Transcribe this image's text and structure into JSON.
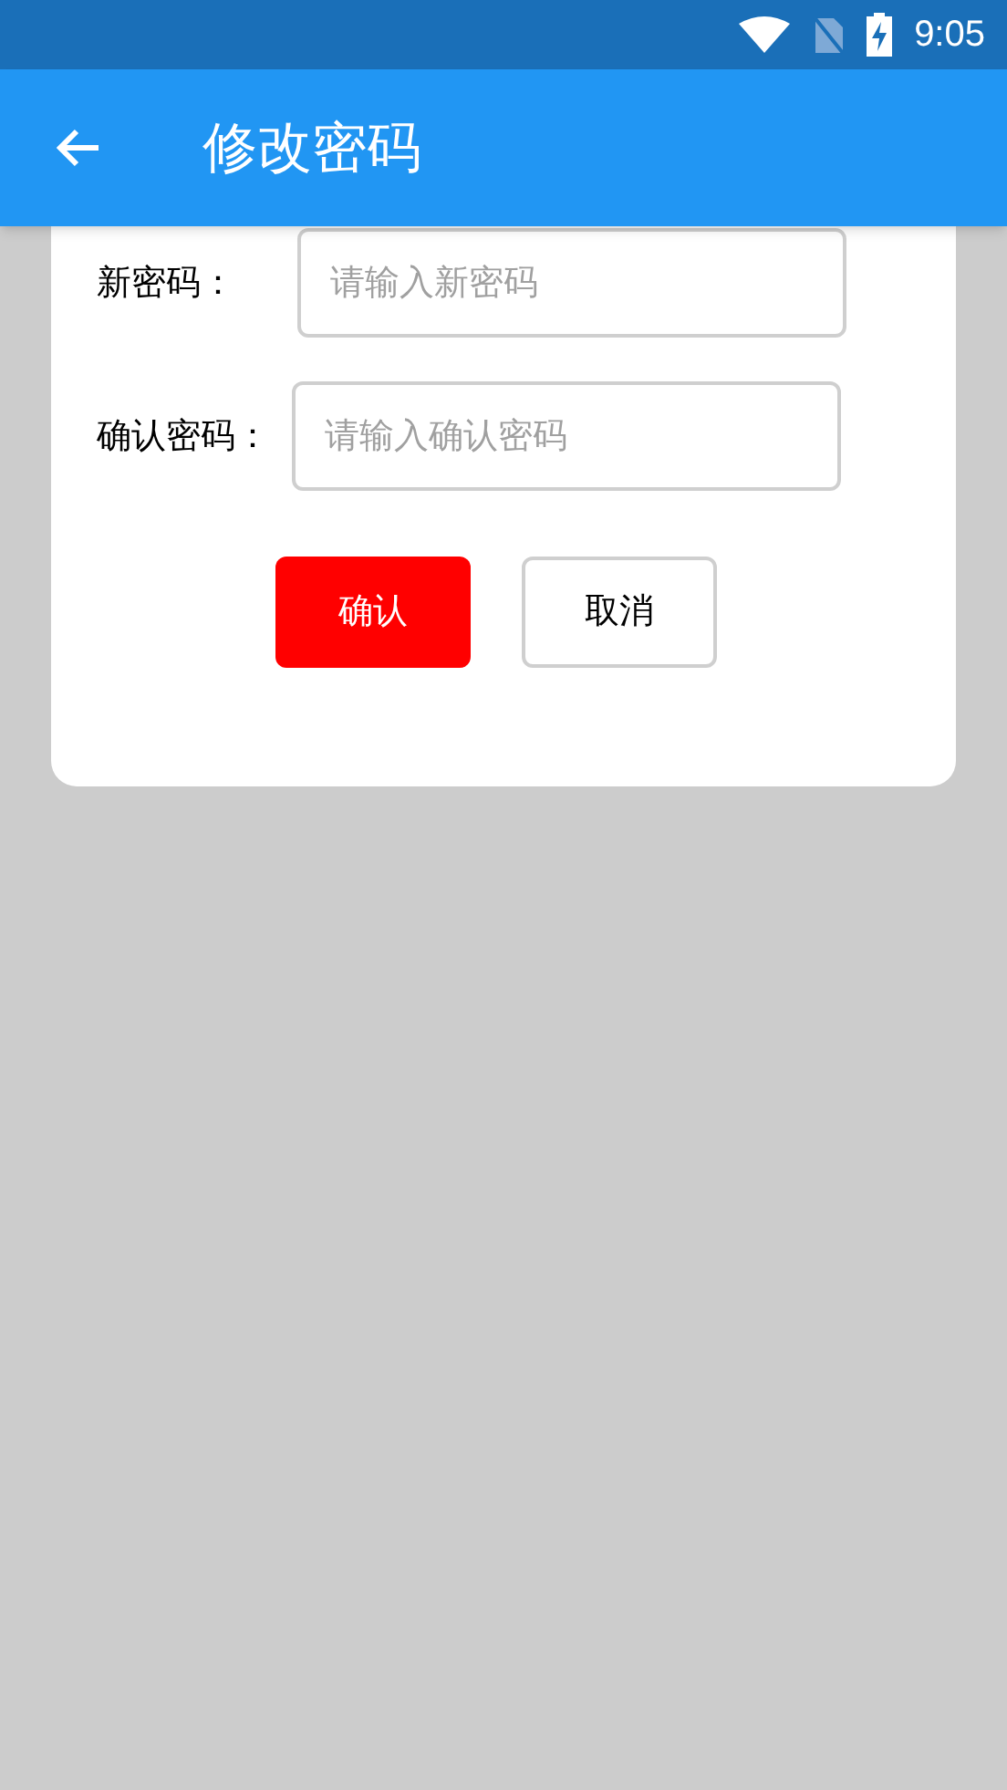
{
  "status_bar": {
    "time": "9:05"
  },
  "app_bar": {
    "title": "修改密码"
  },
  "form": {
    "fields": [
      {
        "label": "新密码：",
        "placeholder": "请输入新密码"
      },
      {
        "label": "确认密码：",
        "placeholder": "请输入确认密码"
      }
    ],
    "buttons": [
      {
        "label": "确认",
        "kind": "primary"
      },
      {
        "label": "取消",
        "kind": "secondary"
      }
    ]
  }
}
